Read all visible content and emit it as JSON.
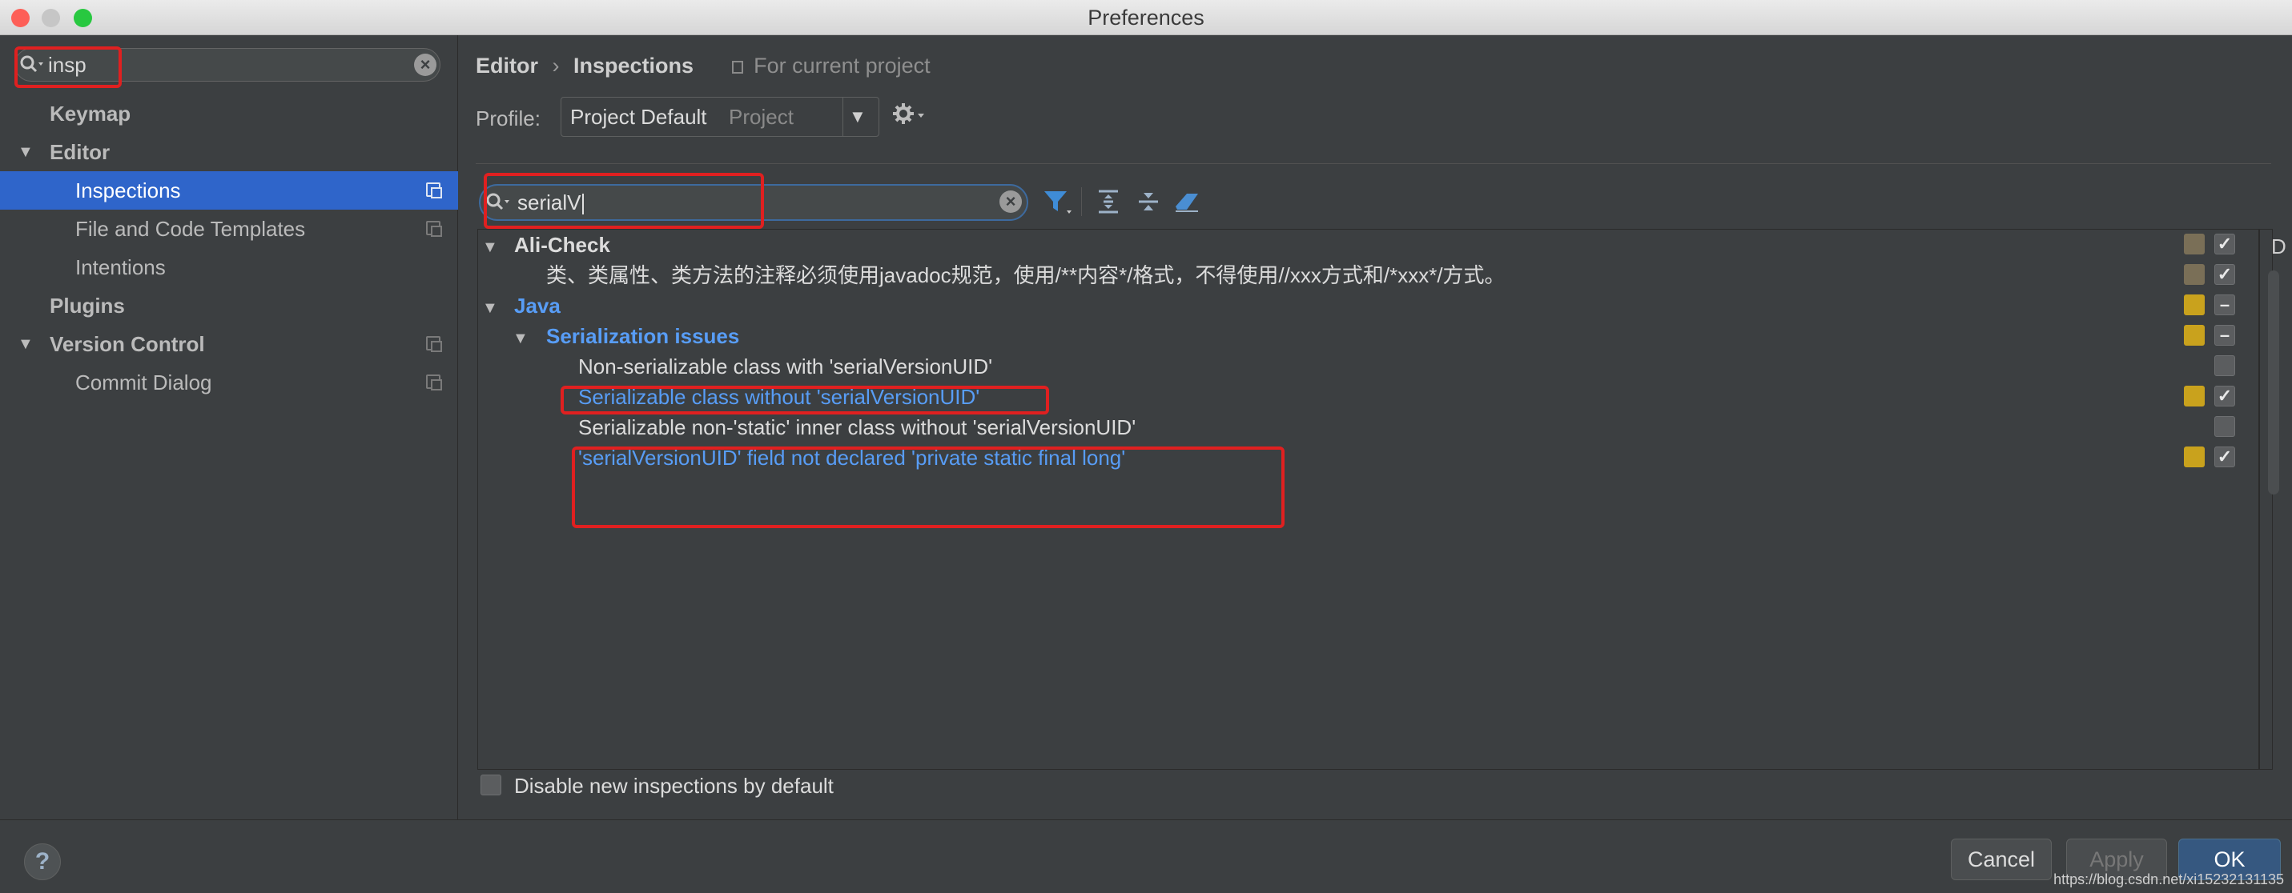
{
  "window": {
    "title": "Preferences",
    "traffic_lights": [
      "#fd5f57",
      "#c6c6c6",
      "#28c840"
    ]
  },
  "sidebar": {
    "search_value": "insp",
    "items": [
      {
        "label": "Keymap"
      },
      {
        "label": "Editor"
      },
      {
        "label": "Inspections"
      },
      {
        "label": "File and Code Templates"
      },
      {
        "label": "Intentions"
      },
      {
        "label": "Plugins"
      },
      {
        "label": "Version Control"
      },
      {
        "label": "Commit Dialog"
      }
    ]
  },
  "breadcrumb": {
    "parent": "Editor",
    "separator": "›",
    "current": "Inspections",
    "scope": "For current project"
  },
  "profile": {
    "label": "Profile:",
    "value": "Project Default",
    "scope": "Project"
  },
  "filter": {
    "value": "serialV"
  },
  "tree": {
    "ali_check": "Ali-Check",
    "ali_rule": "类、类属性、类方法的注释必须使用javadoc规范，使用/**内容*/格式，不得使用//xxx方式和/*xxx*/方式。",
    "java": "Java",
    "serialization": "Serialization issues",
    "items": [
      "Non-serializable class with 'serialVersionUID'",
      "Serializable class without 'serialVersionUID'",
      "Serializable non-'static' inner class without 'serialVersionUID'",
      "'serialVersionUID' field not declared 'private static final long'"
    ],
    "edge_label": "D"
  },
  "footer": {
    "disable_label": "Disable new inspections by default",
    "help": "?",
    "cancel": "Cancel",
    "apply": "Apply",
    "ok": "OK",
    "watermark": "https://blog.csdn.net/xi15232131135"
  },
  "colors": {
    "accent": "#2f65ca",
    "link": "#589df6",
    "highlight": "#e02020",
    "severity_warning": "#c9a21d",
    "severity_custom": "#7a6f57"
  }
}
